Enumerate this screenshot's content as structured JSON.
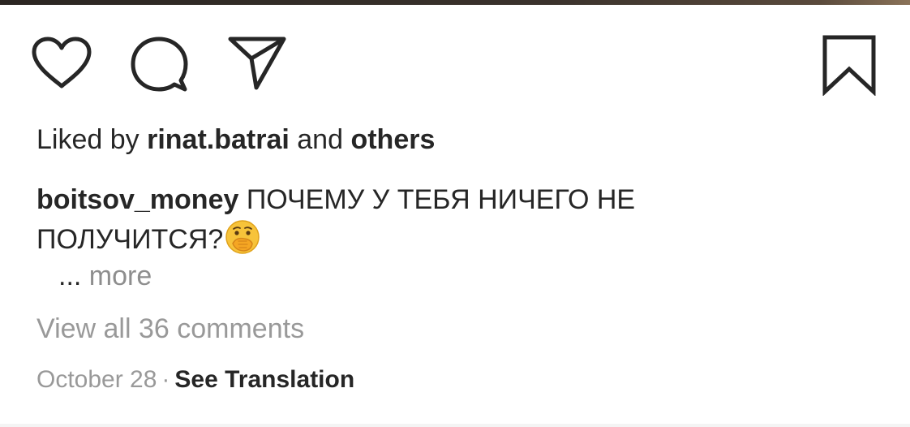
{
  "post": {
    "likes": {
      "prefix": "Liked by",
      "user": "rinat.batrai",
      "conjunction": "and",
      "others": "others"
    },
    "caption": {
      "username": "boitsov_money",
      "text_line1": "ПОЧЕМУ У ТЕБЯ НИЧЕГО НЕ",
      "text_line2": "ПОЛУЧИТСЯ?",
      "emoji": "face-with-hand-over-mouth-emoji"
    },
    "more": {
      "dots": "...",
      "label": "more"
    },
    "view_comments": "View all 36 comments",
    "date": "October 28",
    "separator": "·",
    "translate": "See Translation"
  },
  "icons": {
    "like": "heart-icon",
    "comment": "comment-bubble-icon",
    "share": "paper-plane-icon",
    "save": "bookmark-icon"
  }
}
